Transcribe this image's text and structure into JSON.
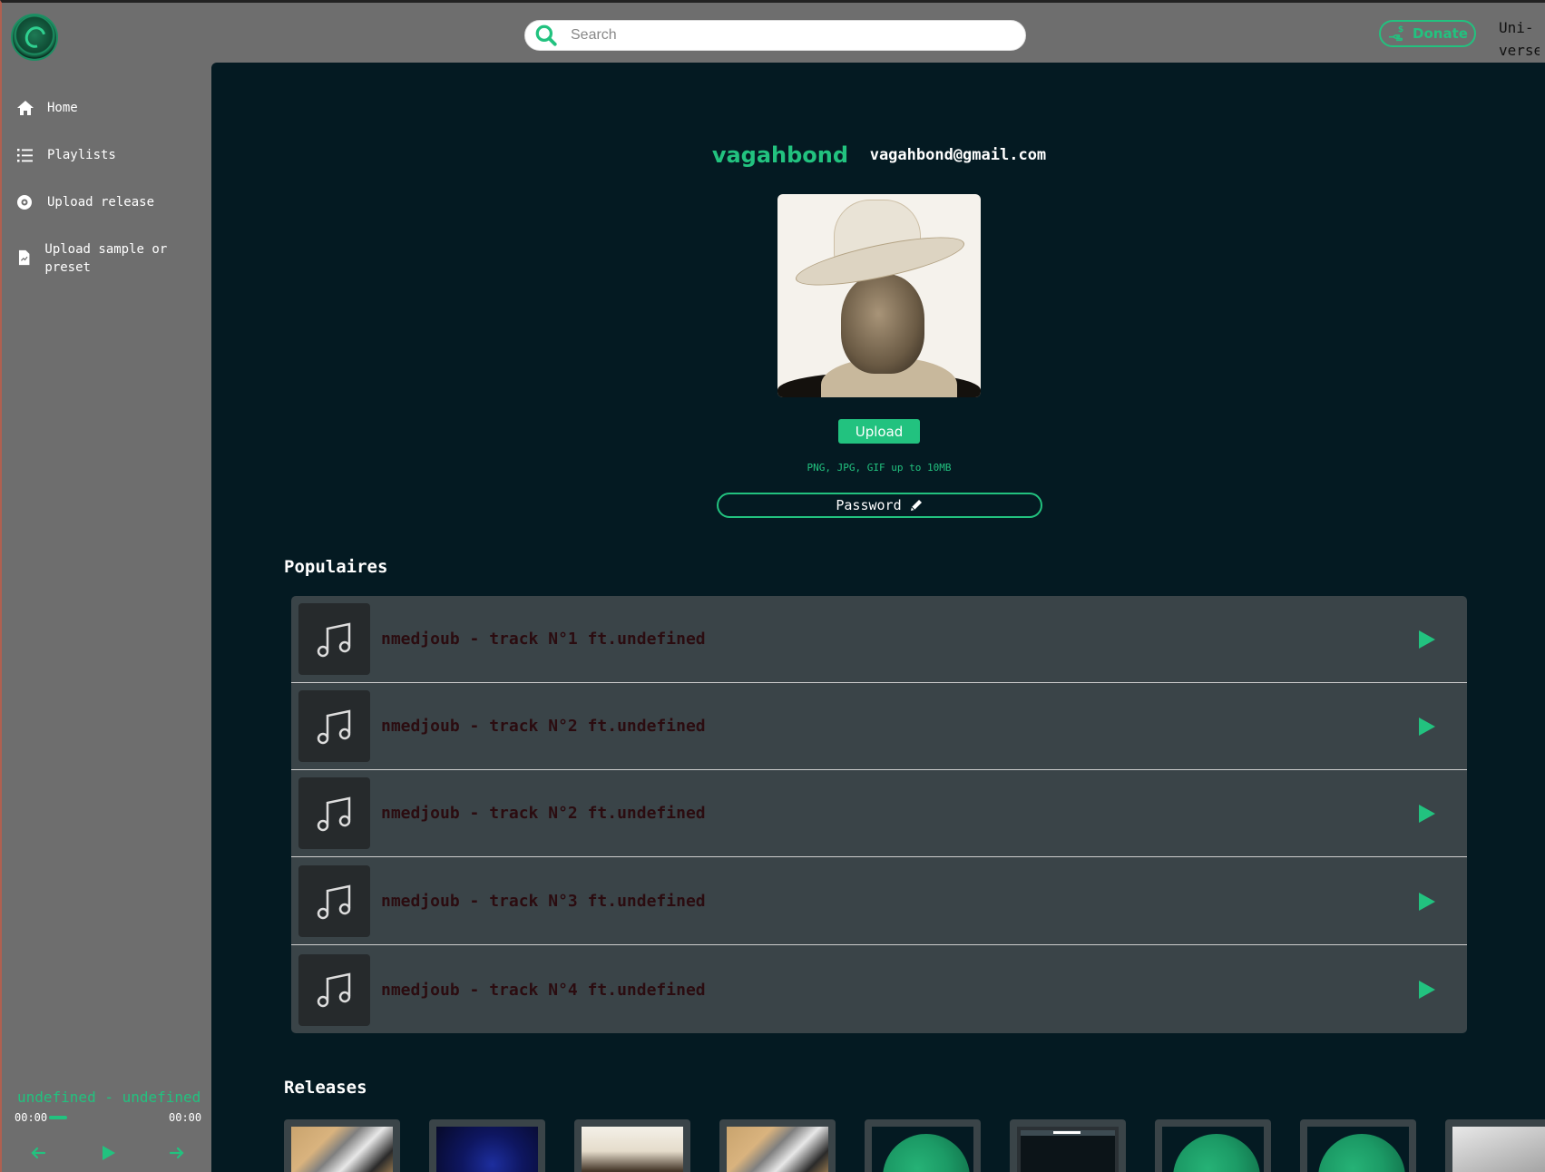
{
  "header": {
    "search_placeholder": "Search",
    "donate_label": "Donate",
    "universe_label_line1": "Uni-",
    "universe_label_line2": "verse"
  },
  "sidebar": {
    "items": [
      {
        "label": "Home",
        "icon": "home-icon"
      },
      {
        "label": "Playlists",
        "icon": "list-icon"
      },
      {
        "label": "Upload release",
        "icon": "disc-icon"
      },
      {
        "label": "Upload sample or preset",
        "icon": "file-icon"
      }
    ]
  },
  "player": {
    "now_playing": "undefined - undefined",
    "current_time": "00:00",
    "duration": "00:00",
    "progress": 0.1
  },
  "profile": {
    "username": "vagahbond",
    "email": "vagahbond@gmail.com",
    "upload_label": "Upload",
    "upload_hint": "PNG, JPG, GIF up to 10MB",
    "password_label": "Password"
  },
  "populaires": {
    "title": "Populaires",
    "tracks": [
      {
        "title": "nmedjoub - track N°1 ft.undefined"
      },
      {
        "title": "nmedjoub - track N°2 ft.undefined"
      },
      {
        "title": "nmedjoub - track N°2 ft.undefined"
      },
      {
        "title": "nmedjoub - track N°3 ft.undefined"
      },
      {
        "title": "nmedjoub - track N°4 ft.undefined"
      }
    ]
  },
  "releases": {
    "title": "Releases"
  },
  "colors": {
    "accent": "#22c27f",
    "main_bg": "#041a22",
    "sidebar_bg": "#6e6e6e",
    "track_bg": "#3a4448",
    "track_text": "#2b0c10"
  }
}
